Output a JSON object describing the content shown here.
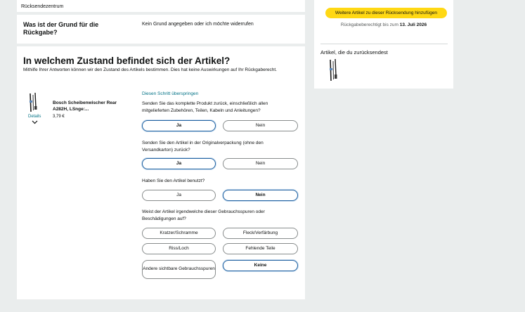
{
  "breadcrumb": "Rücksendezentrum",
  "reason": {
    "label": "Was ist der Grund für die Rückgabe?",
    "value": "Kein Grund angegeben oder ich möchte widerrufen"
  },
  "condition": {
    "title": "In welchem Zustand befindet sich der Artikel?",
    "subtitle": "Mithilfe Ihrer Antworten können wir den Zustand des Artikels bestimmen. Dies hat keine Auswirkungen auf Ihr Rückgaberecht.",
    "skip_link": "Diesen Schritt überspringen"
  },
  "product": {
    "name": "Bosch Scheibenwischer Rear A282H, LSnge:...",
    "price": "3,79 €",
    "details_link": "Details"
  },
  "questions": [
    {
      "text": "Senden Sie das komplette Produkt zurück, einschließlich allen mitgelieferten Zubehören, Teilen, Kabeln und Anleitungen?",
      "options": [
        "Ja",
        "Nein"
      ],
      "selected": "Ja"
    },
    {
      "text": "Senden Sie den Artikel in der Originalverpackung (ohne den Versandkarton) zurück?",
      "options": [
        "Ja",
        "Nein"
      ],
      "selected": "Ja"
    },
    {
      "text": "Haben Sie den Artikel benutzt?",
      "options": [
        "Ja",
        "Nein"
      ],
      "selected": "Nein"
    },
    {
      "text": "Weist der Artikel irgendwelche dieser Gebrauchsspuren oder Beschädigungen auf?",
      "options": [
        "Kratzer/Schramme",
        "Fleck/Verfärbung",
        "Riss/Loch",
        "Fehlende Teile",
        "Andere sichtbare Gebrauchsspuren",
        "Keine"
      ],
      "selected": "Keine"
    }
  ],
  "sidebar": {
    "add_button": "Weitere Artikel zu dieser Rücksendung hinzufügen",
    "deadline_prefix": "Rückgabeberechtigt bis zum",
    "deadline_date": "13. Juli 2026",
    "items_heading": "Artikel, die du zurücksendest"
  },
  "colors": {
    "accent_yellow": "#ffd814",
    "selected_border": "#2162a1",
    "link": "#007185"
  }
}
